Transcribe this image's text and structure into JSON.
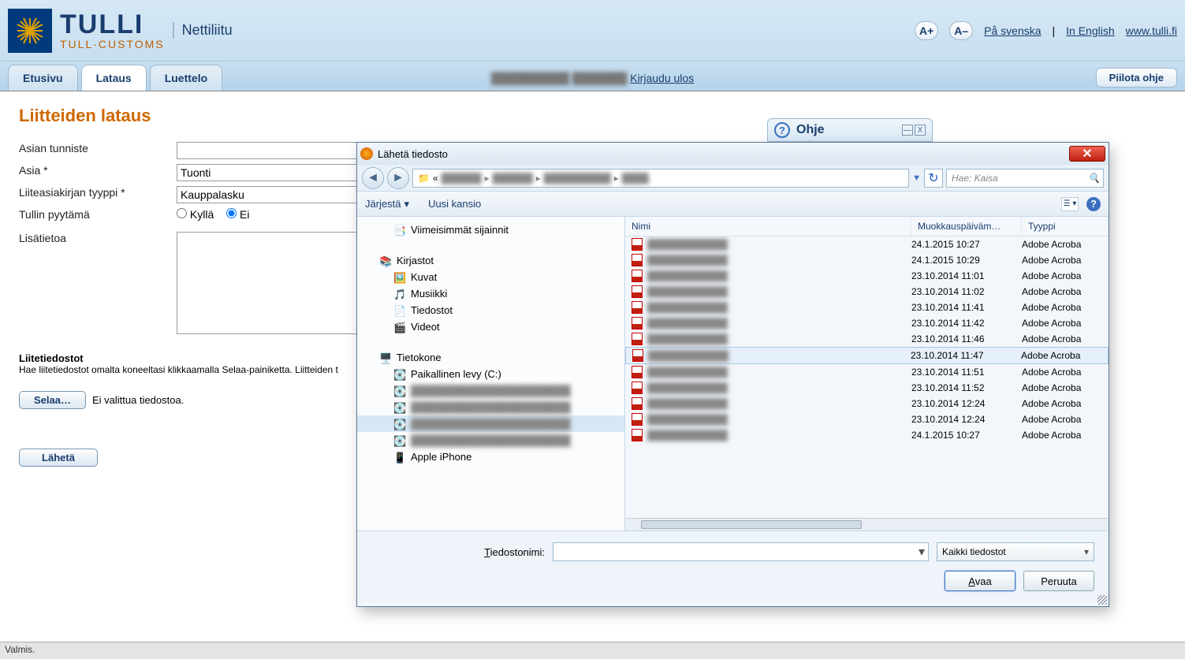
{
  "header": {
    "logo_main": "TULLI",
    "logo_sub": "TULL·CUSTOMS",
    "site_title": "Nettiliitu",
    "zoom_in": "A+",
    "zoom_out": "A–",
    "lang_se": "På svenska",
    "lang_en": "In English",
    "link_site": "www.tulli.fi"
  },
  "tabs": {
    "etusivu": "Etusivu",
    "lataus": "Lataus",
    "luettelo": "Luettelo",
    "user_blur": "██████████ ███████",
    "logout": "Kirjaudu ulos",
    "hide_help": "Piilota ohje"
  },
  "page": {
    "title": "Liitteiden lataus",
    "labels": {
      "asian_tunniste": "Asian tunniste",
      "asia": "Asia *",
      "tyyppi": "Liiteasiakirjan tyyppi *",
      "pyytama": "Tullin pyytämä",
      "lisatietoa": "Lisätietoa",
      "liitetiedostot": "Liitetiedostot",
      "liite_desc": "Hae liitetiedostot omalta koneeltasi klikkaamalla Selaa-painiketta. Liitteiden t",
      "nofile": "Ei valittua tiedostoa."
    },
    "values": {
      "asia": "Tuonti",
      "tyyppi": "Kauppalasku",
      "kylla": "Kyllä",
      "ei": "Ei"
    },
    "buttons": {
      "selaa": "Selaa…",
      "laheta": "Lähetä"
    }
  },
  "ohje": {
    "title": "Ohje"
  },
  "status": "Valmis.",
  "dialog": {
    "title": "Lähetä tiedosto",
    "search_placeholder": "Hae: Kaisa",
    "toolbar": {
      "jarjesta": "Järjestä",
      "uusi": "Uusi kansio"
    },
    "tree": {
      "viimeisimmat": "Viimeisimmät sijainnit",
      "kirjastot": "Kirjastot",
      "kuvat": "Kuvat",
      "musiikki": "Musiikki",
      "tiedostot": "Tiedostot",
      "videot": "Videot",
      "tietokone": "Tietokone",
      "paikallinen": "Paikallinen levy (C:)",
      "apple": "Apple iPhone"
    },
    "columns": {
      "nimi": "Nimi",
      "muokkaus": "Muokkauspäiväm…",
      "tyyppi": "Tyyppi"
    },
    "files": [
      {
        "date": "24.1.2015 10:27",
        "type": "Adobe Acroba"
      },
      {
        "date": "24.1.2015 10:29",
        "type": "Adobe Acroba"
      },
      {
        "date": "23.10.2014 11:01",
        "type": "Adobe Acroba"
      },
      {
        "date": "23.10.2014 11:02",
        "type": "Adobe Acroba"
      },
      {
        "date": "23.10.2014 11:41",
        "type": "Adobe Acroba"
      },
      {
        "date": "23.10.2014 11:42",
        "type": "Adobe Acroba"
      },
      {
        "date": "23.10.2014 11:46",
        "type": "Adobe Acroba"
      },
      {
        "date": "23.10.2014 11:47",
        "type": "Adobe Acroba",
        "sel": true
      },
      {
        "date": "23.10.2014 11:51",
        "type": "Adobe Acroba"
      },
      {
        "date": "23.10.2014 11:52",
        "type": "Adobe Acroba"
      },
      {
        "date": "23.10.2014 12:24",
        "type": "Adobe Acroba"
      },
      {
        "date": "23.10.2014 12:24",
        "type": "Adobe Acroba"
      },
      {
        "date": "24.1.2015 10:27",
        "type": "Adobe Acroba"
      }
    ],
    "footer": {
      "filelabel": "Tiedostonimi:",
      "filetype": "Kaikki tiedostot",
      "open": "Avaa",
      "cancel": "Peruuta"
    }
  }
}
